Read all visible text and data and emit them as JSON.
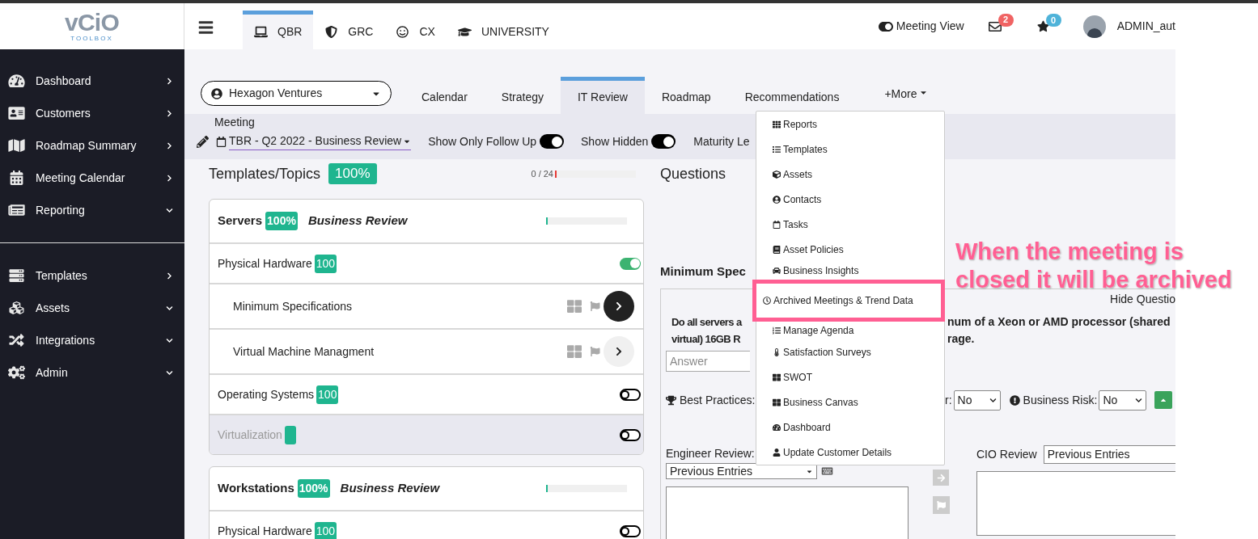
{
  "logo": {
    "main": "vCiO",
    "sub": "TOOLBOX"
  },
  "sidebar": {
    "groups": [
      [
        {
          "label": "Dashboard",
          "expanded": false
        },
        {
          "label": "Customers",
          "expanded": false
        },
        {
          "label": "Roadmap Summary",
          "expanded": false
        },
        {
          "label": "Meeting Calendar",
          "expanded": false
        },
        {
          "label": "Reporting",
          "expanded": true
        }
      ],
      [
        {
          "label": "Templates",
          "expanded": false
        },
        {
          "label": "Assets",
          "expanded": true
        },
        {
          "label": "Integrations",
          "expanded": true
        },
        {
          "label": "Admin",
          "expanded": true
        }
      ]
    ]
  },
  "header": {
    "modules": [
      {
        "label": "QBR",
        "selected": true
      },
      {
        "label": "GRC",
        "selected": false
      },
      {
        "label": "CX",
        "selected": false
      },
      {
        "label": "UNIVERSITY",
        "selected": false
      }
    ],
    "meeting_view": "Meeting View",
    "mail_count": "2",
    "star_count": "0",
    "user": "ADMIN_aut"
  },
  "customer_select": {
    "value": "Hexagon Ventures"
  },
  "tabs": [
    {
      "label": "Calendar",
      "selected": false
    },
    {
      "label": "Strategy",
      "selected": false
    },
    {
      "label": "IT Review",
      "selected": true
    },
    {
      "label": "Roadmap",
      "selected": false
    },
    {
      "label": "Recommendations",
      "selected": false
    }
  ],
  "more_menu": {
    "label": "+More",
    "items": [
      {
        "label": "Reports",
        "highlighted": false
      },
      {
        "label": "Templates",
        "highlighted": false
      },
      {
        "label": "Assets",
        "highlighted": false
      },
      {
        "label": "Contacts",
        "highlighted": false
      },
      {
        "label": "Tasks",
        "highlighted": false
      },
      {
        "label": "Asset Policies",
        "highlighted": false
      },
      {
        "label": "Business Insights",
        "highlighted": false
      },
      {
        "label": "Archived Meetings & Trend Data",
        "highlighted": true
      },
      {
        "label": "Manage Agenda",
        "highlighted": false
      },
      {
        "label": "Satisfaction Surveys",
        "highlighted": false
      },
      {
        "label": "SWOT",
        "highlighted": false
      },
      {
        "label": "Business Canvas",
        "highlighted": false
      },
      {
        "label": "Dashboard",
        "highlighted": false
      },
      {
        "label": "Update Customer Details",
        "highlighted": false
      }
    ]
  },
  "meeting_bar": {
    "label": "Meeting",
    "meeting": "TBR - Q2 2022 - Business Review",
    "toggles": [
      {
        "label": "Show Only Follow Up",
        "on": true
      },
      {
        "label": "Show Hidden",
        "on": true
      }
    ],
    "maturity": "Maturity Le"
  },
  "topics": {
    "title": "Templates/Topics",
    "percent": "100%",
    "count": "0 / 24",
    "level": 0,
    "cards": [
      {
        "title": "Servers",
        "percent": "100%",
        "subtitle": "Business Review",
        "level": 0,
        "rows": [
          {
            "kind": "topic",
            "label": "Physical Hardware",
            "badge": "100",
            "on": true,
            "disabled": false
          },
          {
            "kind": "subtopic",
            "label": "Minimum Specifications",
            "selected": true
          },
          {
            "kind": "subtopic",
            "label": "Virtual Machine Managment",
            "selected": false
          },
          {
            "kind": "topic",
            "label": "Operating Systems",
            "badge": "100",
            "on": false,
            "disabled": false
          },
          {
            "kind": "topic",
            "label": "Virtualization",
            "on": false,
            "disabled": true
          }
        ]
      },
      {
        "title": "Workstations",
        "percent": "100%",
        "subtitle": "Business Review",
        "level": 0,
        "rows": [
          {
            "kind": "topic",
            "label": "Physical Hardware",
            "badge": "100",
            "on": false,
            "disabled": false
          }
        ]
      }
    ]
  },
  "questions": {
    "title": "Questions",
    "section": "Minimum Spec",
    "hide": "Hide Questio",
    "question_left": [
      "Do all servers a",
      "virtual) 16GB R"
    ],
    "question_right": [
      "num of a Xeon or AMD processor (shared",
      "rage."
    ],
    "answer_placeholder": "Answer",
    "best_practices": "Best Practices:",
    "field_fragment": "r:",
    "field_value": "No",
    "business_risk": "Business Risk:",
    "business_risk_value": "No",
    "engineer_review": "Engineer Review:",
    "engineer_select": "Previous Entries",
    "cio_review": "CIO Review",
    "cio_select": "Previous Entries"
  },
  "annotation": {
    "lines": [
      "When the meeting is",
      "closed it will be archived"
    ]
  }
}
